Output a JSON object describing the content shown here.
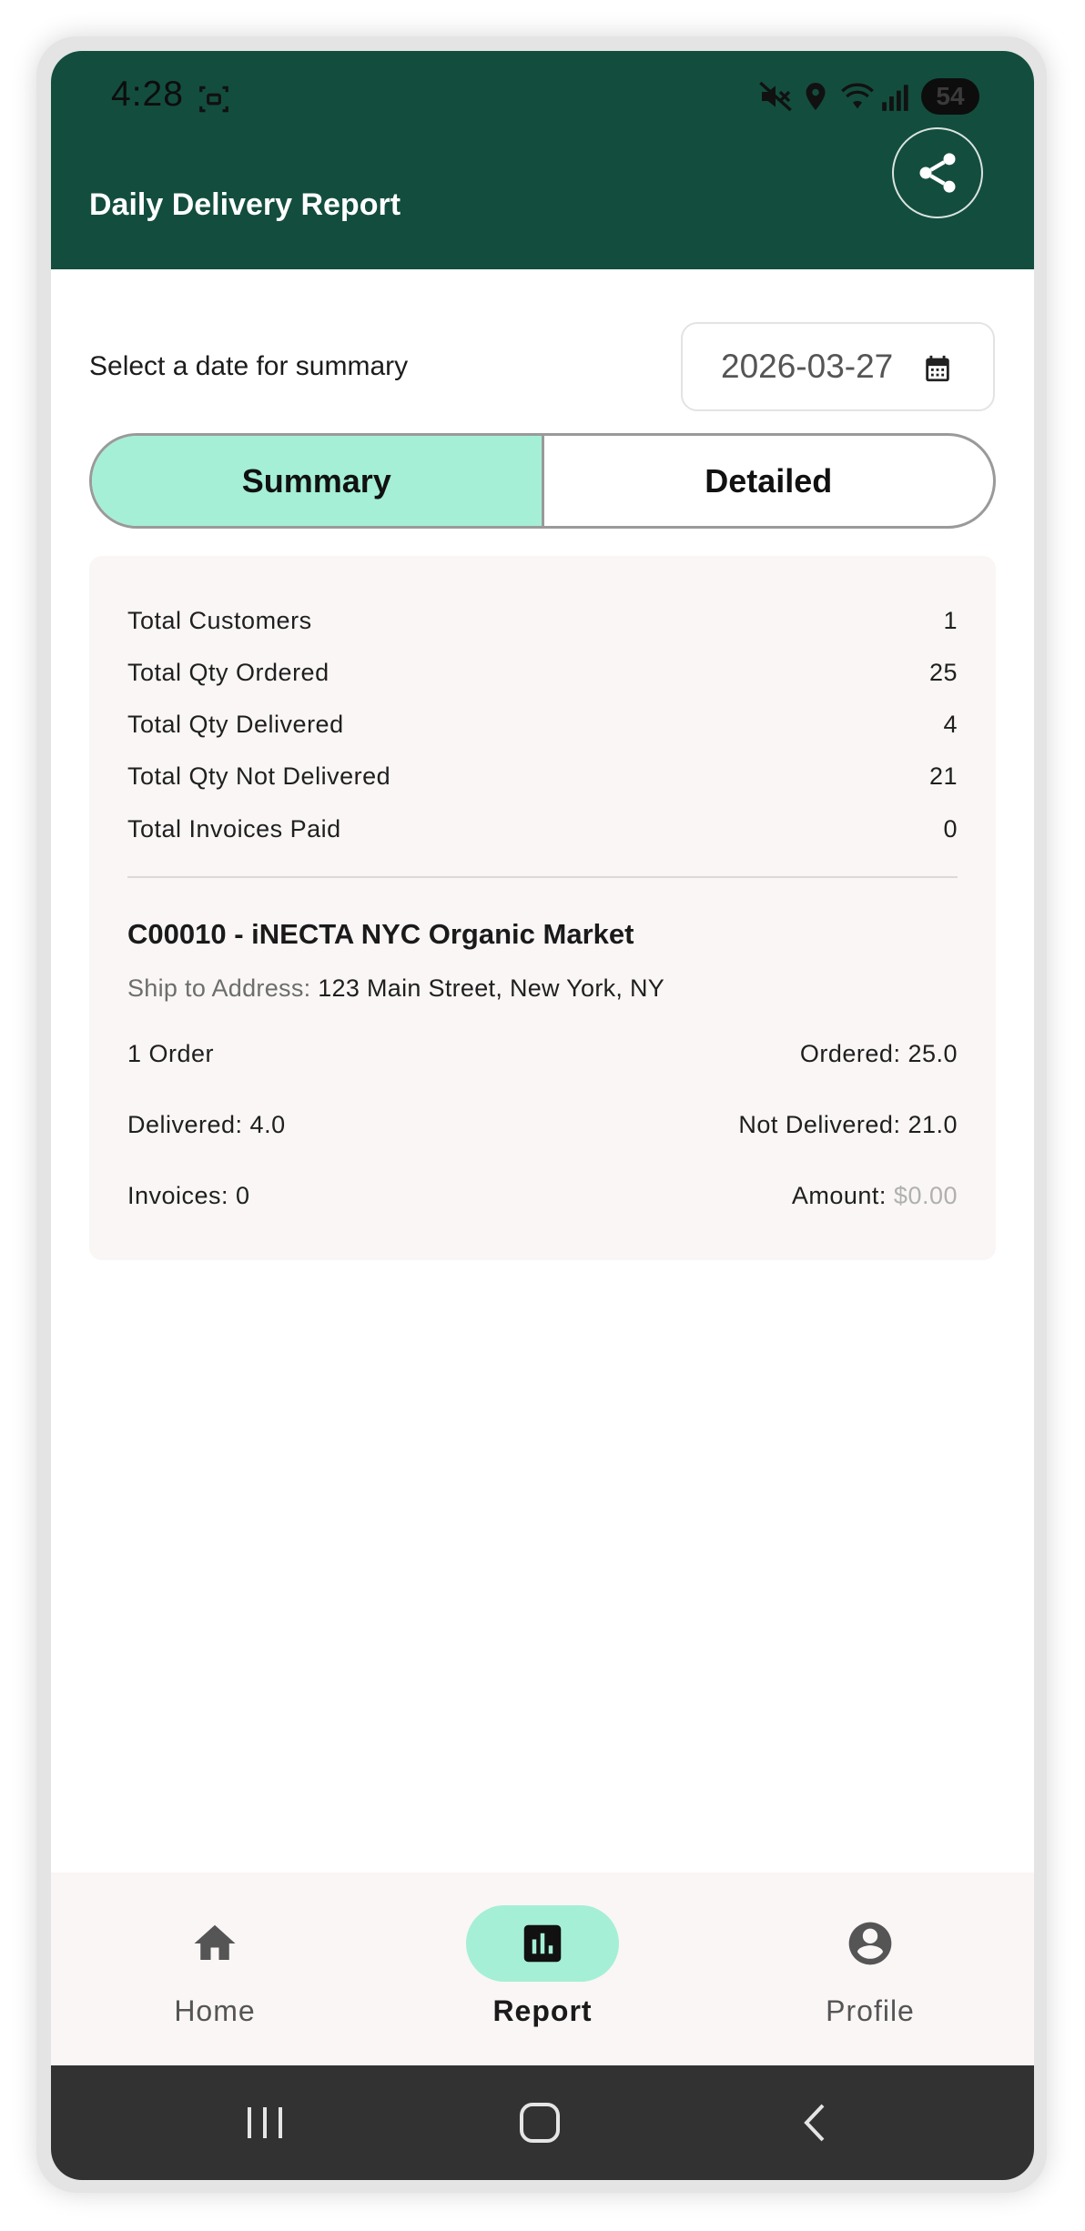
{
  "status_bar": {
    "time": "4:28",
    "battery": "54"
  },
  "app_bar": {
    "title": "Daily Delivery Report",
    "share_icon": "share-icon"
  },
  "date_selector": {
    "label": "Select a date for summary",
    "value": "2026-03-27",
    "icon": "calendar-icon"
  },
  "tabs": {
    "summary": "Summary",
    "detailed": "Detailed",
    "active": "Summary"
  },
  "summary": [
    {
      "label": "Total Customers",
      "value": "1"
    },
    {
      "label": "Total Qty Ordered",
      "value": "25"
    },
    {
      "label": "Total Qty Delivered",
      "value": "4"
    },
    {
      "label": "Total Qty Not Delivered",
      "value": "21"
    },
    {
      "label": "Total Invoices Paid",
      "value": "0"
    }
  ],
  "customer": {
    "title": "C00010 - iNECTA NYC Organic Market",
    "ship_label": "Ship to Address:",
    "ship_value": "123 Main Street, New York, NY",
    "orders": "1 Order",
    "ordered": "Ordered: 25.0",
    "delivered": "Delivered: 4.0",
    "not_delivered": "Not Delivered: 21.0",
    "invoices": "Invoices: 0",
    "amount_label": "Amount:",
    "amount_value": "$0.00"
  },
  "nav": [
    {
      "label": "Home",
      "icon": "home-icon"
    },
    {
      "label": "Report",
      "icon": "bar-chart-icon",
      "active": true
    },
    {
      "label": "Profile",
      "icon": "account-circle-icon"
    }
  ],
  "colors": {
    "header": "#134d3e",
    "accent": "#a5efd6",
    "card": "#f9f6f5"
  }
}
